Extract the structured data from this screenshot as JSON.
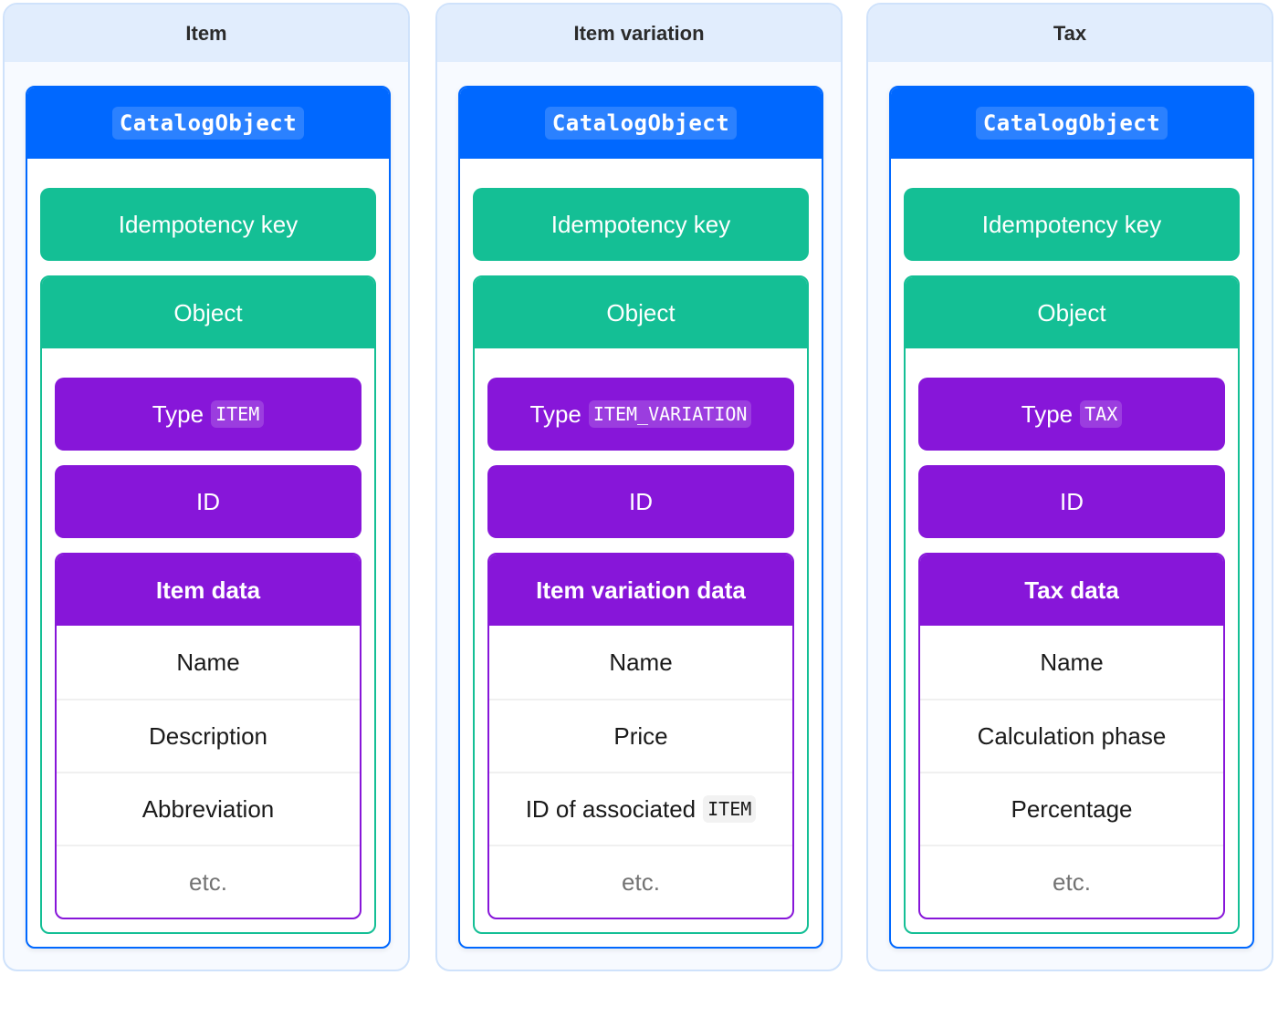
{
  "colors": {
    "panel_border": "#CFE2FB",
    "panel_header": "#E1EDFD",
    "panel_body": "#F7FAFF",
    "catalog_object": "#0068FF",
    "green": "#14BF95",
    "purple": "#8716D9",
    "muted_text": "#737373"
  },
  "panels": [
    {
      "title": "Item",
      "catalog_object_label": "CatalogObject",
      "idempotency_label": "Idempotency key",
      "object_label": "Object",
      "type_label": "Type",
      "type_value": "ITEM",
      "id_label": "ID",
      "data_label": "Item data",
      "rows": [
        {
          "text": "Name",
          "code": null
        },
        {
          "text": "Description",
          "code": null
        },
        {
          "text": "Abbreviation",
          "code": null
        },
        {
          "text": "etc.",
          "code": null,
          "muted": true
        }
      ]
    },
    {
      "title": "Item variation",
      "catalog_object_label": "CatalogObject",
      "idempotency_label": "Idempotency key",
      "object_label": "Object",
      "type_label": "Type",
      "type_value": "ITEM_VARIATION",
      "id_label": "ID",
      "data_label": "Item variation data",
      "rows": [
        {
          "text": "Name",
          "code": null
        },
        {
          "text": "Price",
          "code": null
        },
        {
          "text": "ID of associated",
          "code": "ITEM"
        },
        {
          "text": "etc.",
          "code": null,
          "muted": true
        }
      ]
    },
    {
      "title": "Tax",
      "catalog_object_label": "CatalogObject",
      "idempotency_label": "Idempotency key",
      "object_label": "Object",
      "type_label": "Type",
      "type_value": "TAX",
      "id_label": "ID",
      "data_label": "Tax data",
      "rows": [
        {
          "text": "Name",
          "code": null
        },
        {
          "text": "Calculation phase",
          "code": null
        },
        {
          "text": "Percentage",
          "code": null
        },
        {
          "text": "etc.",
          "code": null,
          "muted": true
        }
      ]
    }
  ]
}
